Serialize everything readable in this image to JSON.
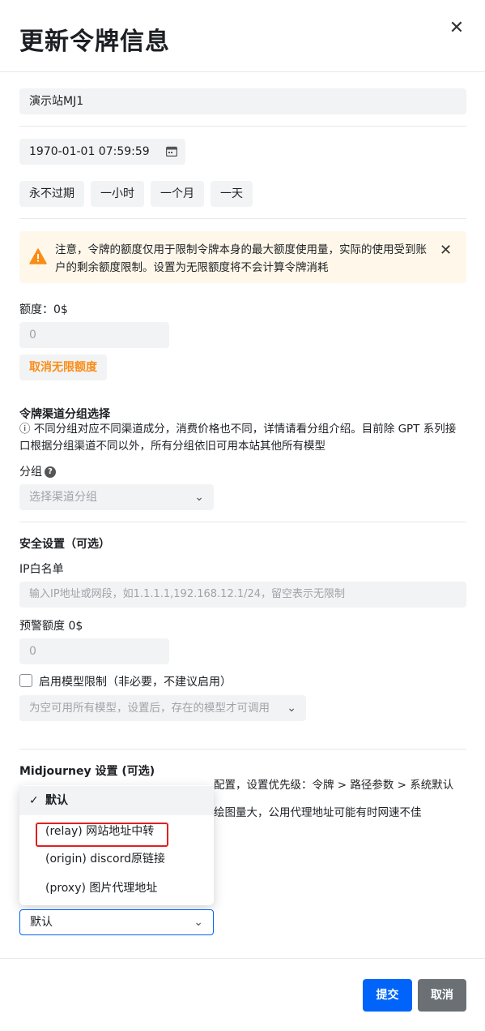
{
  "header": {
    "title": "更新令牌信息",
    "close_icon": "close-icon"
  },
  "name_field": {
    "value": "演示站MJ1"
  },
  "expiry": {
    "value": "1970-01-01 07:59:59",
    "presets": [
      "永不过期",
      "一小时",
      "一个月",
      "一天"
    ]
  },
  "warning": {
    "text": "注意，令牌的额度仅用于限制令牌本身的最大额度使用量，实际的使用受到账户的剩余额度限制。设置为无限额度将不会计算令牌消耗",
    "accent_color": "#fa8c16"
  },
  "quota": {
    "label": "额度：0$",
    "placeholder": "0",
    "unlimited_button": "取消无限额度"
  },
  "group": {
    "heading": "令牌渠道分组选择",
    "note": "ⓘ 不同分组对应不同渠道成分，消费价格也不同，详情请看分组介绍。目前除 GPT 系列接口根据分组渠道不同以外，所有分组依旧可用本站其他所有模型",
    "label": "分组",
    "placeholder": "选择渠道分组"
  },
  "security": {
    "heading": "安全设置（可选）",
    "ip_label": "IP白名单",
    "ip_placeholder": "输入IP地址或网段，如1.1.1.1,192.168.12.1/24，留空表示无限制",
    "alert_label": "预警额度 0$",
    "alert_placeholder": "0",
    "model_limit_label": "启用模型限制（非必要，不建议启用）",
    "model_placeholder": "为空可用所有模型，设置后，存在的模型才可调用"
  },
  "midjourney": {
    "heading": "Midjourney 设置 (可选)",
    "line1_visible": "配置，设置优先级：令牌 > 路径参数 > 系统默认",
    "line2_visible": "绘图量大，公用代理地址可能有时网速不佳",
    "options": [
      "默认",
      "(relay) 网站地址中转",
      "(origin) discord原链接",
      "(proxy) 图片代理地址"
    ],
    "selected": "默认"
  },
  "footer": {
    "submit": "提交",
    "cancel": "取消"
  },
  "colors": {
    "primary": "#0064fa",
    "highlight_border": "#e02020"
  }
}
